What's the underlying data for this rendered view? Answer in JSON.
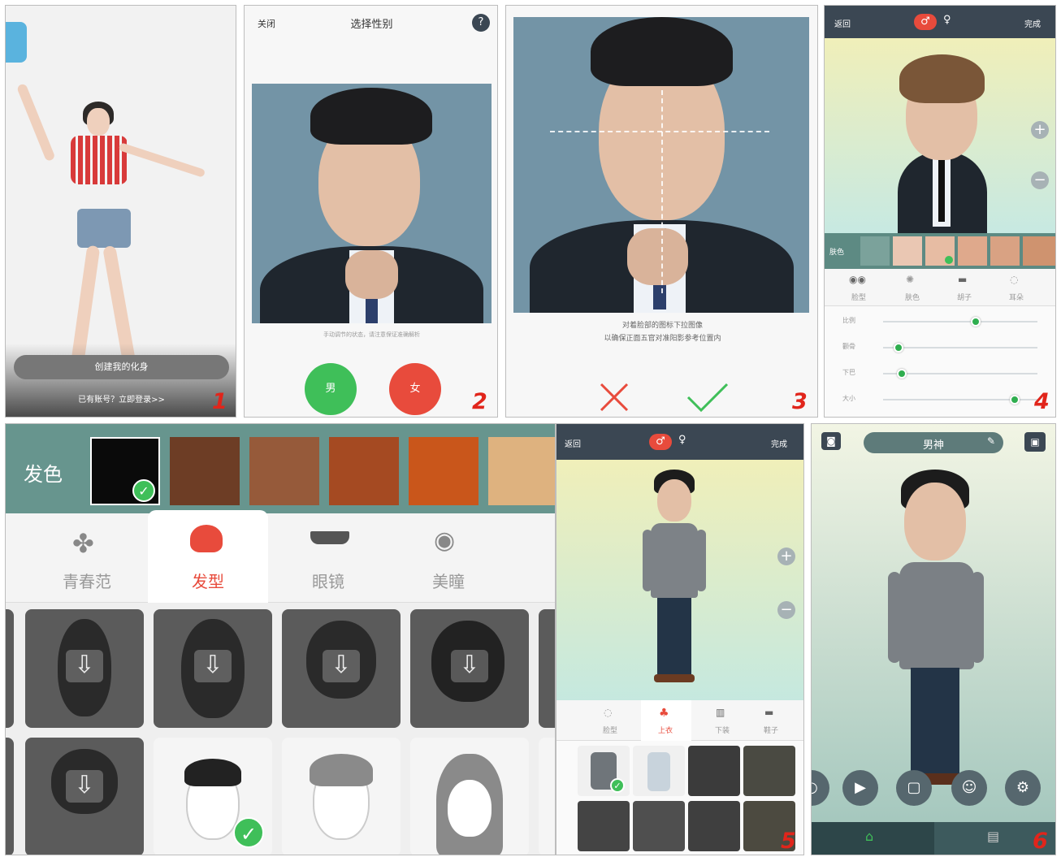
{
  "panel1": {
    "create_button": "创建我的化身",
    "login_link": "已有账号？立即登录>>",
    "number": "1"
  },
  "panel2": {
    "close": "关闭",
    "title": "选择性别",
    "help": "?",
    "hint": "手动调节的状态，请注意保证准确解析",
    "male": "男",
    "female": "女",
    "number": "2"
  },
  "panel3": {
    "instruction_line1": "对着脸部的图标下拉图像",
    "instruction_line2": "以确保正面五官对准阳影参考位置内",
    "cancel_icon": "cross-icon",
    "confirm_icon": "check-icon",
    "number": "3"
  },
  "panel4": {
    "back": "返回",
    "done": "完成",
    "skin_label": "肤色",
    "tabs": [
      "脸型",
      "肤色",
      "胡子",
      "耳朵"
    ],
    "sliders": [
      {
        "label": "比例",
        "value": 0.6
      },
      {
        "label": "颧骨",
        "value": 0.1
      },
      {
        "label": "下巴",
        "value": 0.12
      },
      {
        "label": "大小",
        "value": 0.85
      }
    ],
    "skin_colors": [
      "#eac7b3",
      "#e7bca3",
      "#dfa98c",
      "#d9a283",
      "#cf936f"
    ],
    "number": "4"
  },
  "panel_hair": {
    "color_label": "发色",
    "hair_colors": [
      "#0a0a0a",
      "#6d3d25",
      "#965a3a",
      "#a54a22",
      "#c9561b",
      "#deb27f"
    ],
    "tabs": [
      "青春范",
      "发型",
      "眼镜",
      "美瞳"
    ],
    "active_tab": "发型"
  },
  "panel5": {
    "back": "返回",
    "done": "完成",
    "tabs": [
      "脸型",
      "上衣",
      "下装",
      "鞋子"
    ],
    "number": "5"
  },
  "panel6": {
    "name": "男神",
    "number": "6"
  },
  "colors": {
    "accent_red": "#e84b3c",
    "accent_green": "#3fbf59",
    "number_red": "#e1251b"
  }
}
